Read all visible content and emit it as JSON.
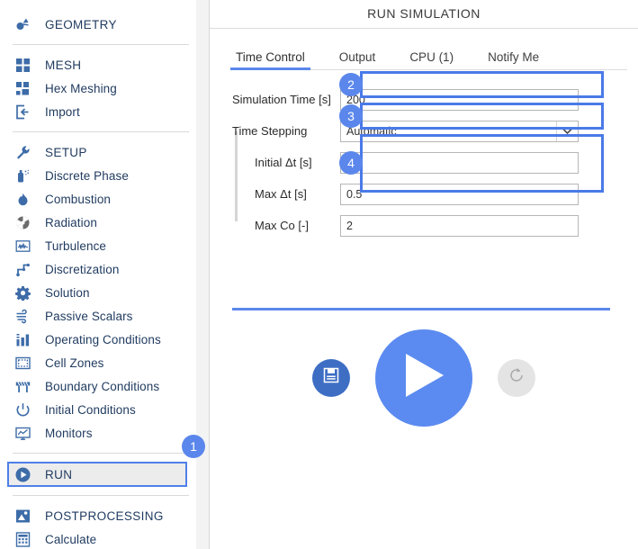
{
  "sidebar": {
    "groups": [
      {
        "items": [
          {
            "label": "GEOMETRY",
            "icon": "geometry-icon",
            "caps": true
          }
        ]
      },
      {
        "items": [
          {
            "label": "MESH",
            "icon": "mesh-icon",
            "caps": true
          },
          {
            "label": "Hex Meshing",
            "icon": "hex-meshing-icon",
            "caps": false
          },
          {
            "label": "Import",
            "icon": "import-icon",
            "caps": false
          }
        ]
      },
      {
        "items": [
          {
            "label": "SETUP",
            "icon": "wrench-icon",
            "caps": true
          },
          {
            "label": "Discrete Phase",
            "icon": "spray-icon",
            "caps": false
          },
          {
            "label": "Combustion",
            "icon": "flame-icon",
            "caps": false
          },
          {
            "label": "Radiation",
            "icon": "radiation-icon",
            "caps": false
          },
          {
            "label": "Turbulence",
            "icon": "turbulence-icon",
            "caps": false
          },
          {
            "label": "Discretization",
            "icon": "discretization-icon",
            "caps": false
          },
          {
            "label": "Solution",
            "icon": "gear-icon",
            "caps": false
          },
          {
            "label": "Passive Scalars",
            "icon": "wind-icon",
            "caps": false
          },
          {
            "label": "Operating Conditions",
            "icon": "bar-chart-icon",
            "caps": false
          },
          {
            "label": "Cell Zones",
            "icon": "cell-zones-icon",
            "caps": false
          },
          {
            "label": "Boundary Conditions",
            "icon": "barrier-icon",
            "caps": false
          },
          {
            "label": "Initial Conditions",
            "icon": "power-icon",
            "caps": false
          },
          {
            "label": "Monitors",
            "icon": "monitor-icon",
            "caps": false
          }
        ]
      },
      {
        "items": [
          {
            "label": "RUN",
            "icon": "play-circle-icon",
            "caps": true,
            "selected": true
          }
        ]
      },
      {
        "items": [
          {
            "label": "POSTPROCESSING",
            "icon": "postprocessing-icon",
            "caps": true
          },
          {
            "label": "Calculate",
            "icon": "calculate-icon",
            "caps": false
          }
        ]
      }
    ]
  },
  "panel": {
    "title": "RUN SIMULATION",
    "tabs": [
      {
        "label": "Time Control",
        "active": true
      },
      {
        "label": "Output",
        "active": false
      },
      {
        "label": "CPU  (1)",
        "active": false
      },
      {
        "label": "Notify Me",
        "active": false
      }
    ]
  },
  "form": {
    "simulation_time": {
      "label": "Simulation Time [s]",
      "value": "200"
    },
    "time_stepping": {
      "label": "Time Stepping",
      "value": "Automatic"
    },
    "initial_dt": {
      "label": "Initial Δt [s]",
      "value": "0.1"
    },
    "max_dt": {
      "label": "Max Δt [s]",
      "value": "0.5"
    },
    "max_co": {
      "label": "Max Co [-]",
      "value": "2"
    }
  },
  "badges": {
    "run_nav": "1",
    "simulation_time": "2",
    "time_stepping": "3",
    "timestep_group": "4"
  },
  "actions": {
    "save": "save-icon",
    "run": "play-icon",
    "reset": "reset-icon"
  },
  "colors": {
    "accent": "#5b87ec",
    "run_button": "#5b8bf0",
    "save_button": "#3e6ec4",
    "reset_button": "#e4e4e4",
    "icon_blue": "#3d6ca8",
    "text": "#1f3a5f"
  }
}
